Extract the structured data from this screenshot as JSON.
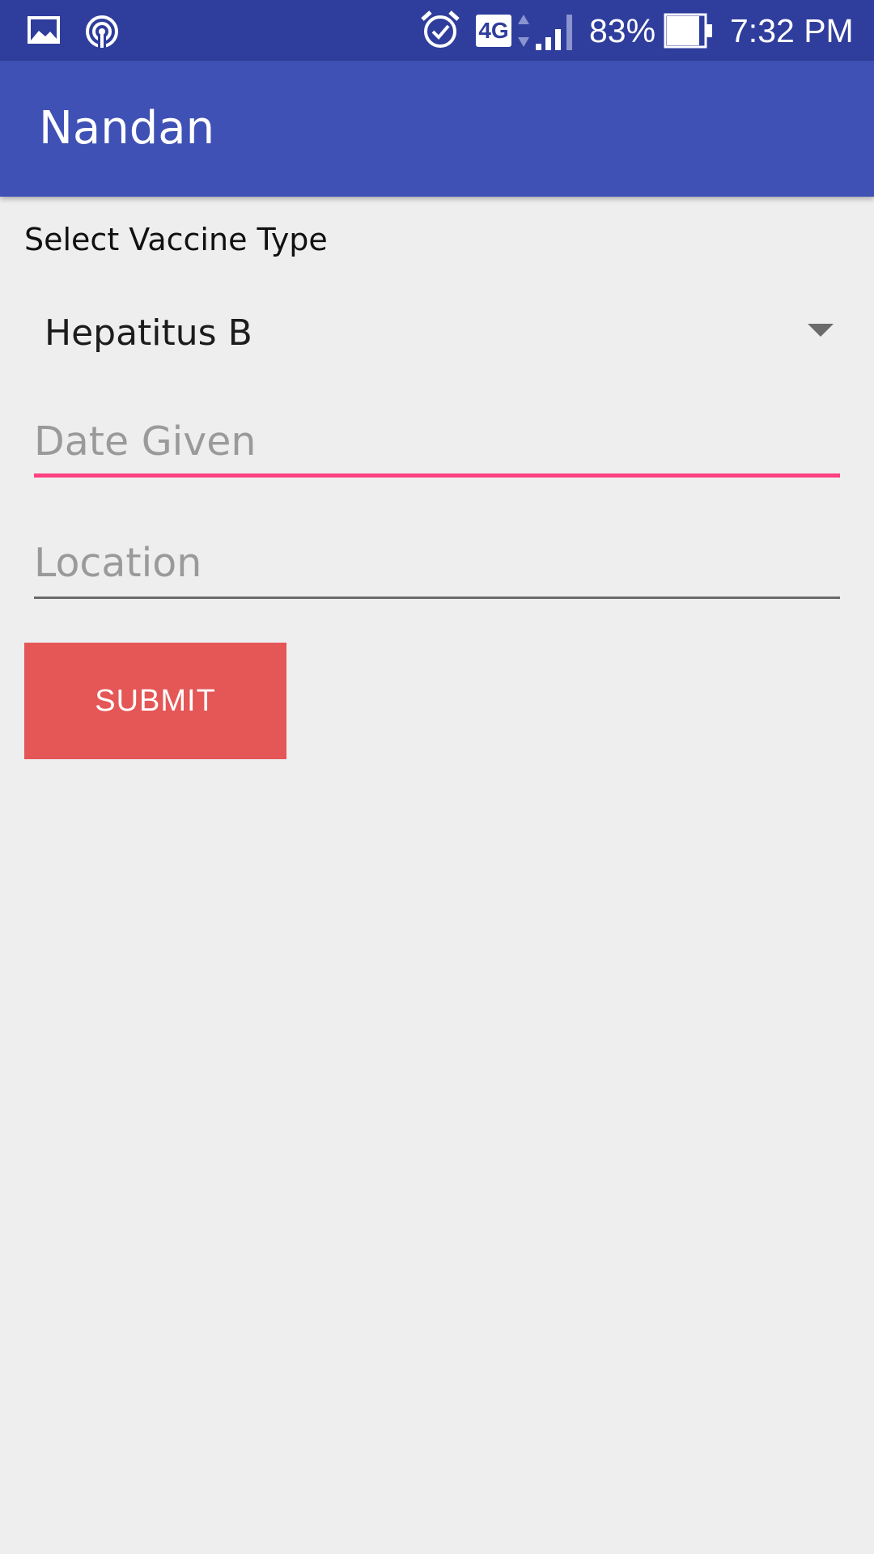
{
  "status_bar": {
    "battery_percent": "83%",
    "time": "7:32 PM",
    "network_label": "4G",
    "icons": [
      "gallery-icon",
      "hotspot-icon",
      "alarm-icon",
      "network-4g-icon",
      "signal-icon",
      "battery-icon"
    ]
  },
  "app_bar": {
    "title": "Nandan"
  },
  "form": {
    "vaccine_label": "Select Vaccine Type",
    "vaccine_selected": "Hepatitus B",
    "date_placeholder": "Date Given",
    "location_placeholder": "Location",
    "submit_label": "SUBMIT"
  },
  "colors": {
    "status_bar": "#2f3d9c",
    "app_bar": "#3f51b5",
    "focus_accent": "#ff4081",
    "submit_button": "#e55656",
    "background": "#eeeeef"
  }
}
